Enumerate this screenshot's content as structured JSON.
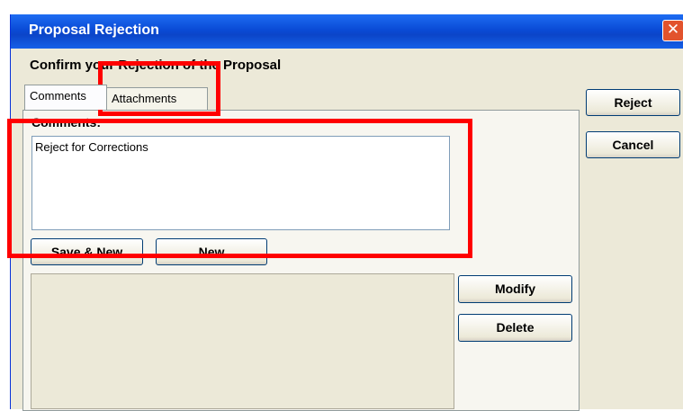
{
  "window": {
    "title": "Proposal Rejection",
    "close_glyph": "✕"
  },
  "dialog": {
    "heading": "Confirm your Rejection of the Proposal"
  },
  "tabs": [
    {
      "label": "Comments"
    },
    {
      "label": "Attachments"
    }
  ],
  "comments": {
    "label": "Comments:",
    "value": "Reject for Corrections"
  },
  "buttons": {
    "save_new": "Save & New",
    "new": "New",
    "modify": "Modify",
    "delete": "Delete",
    "reject": "Reject",
    "cancel": "Cancel"
  },
  "colors": {
    "titlebar": "#0a4bd6",
    "highlight": "#ff0000",
    "close": "#e2532d"
  }
}
